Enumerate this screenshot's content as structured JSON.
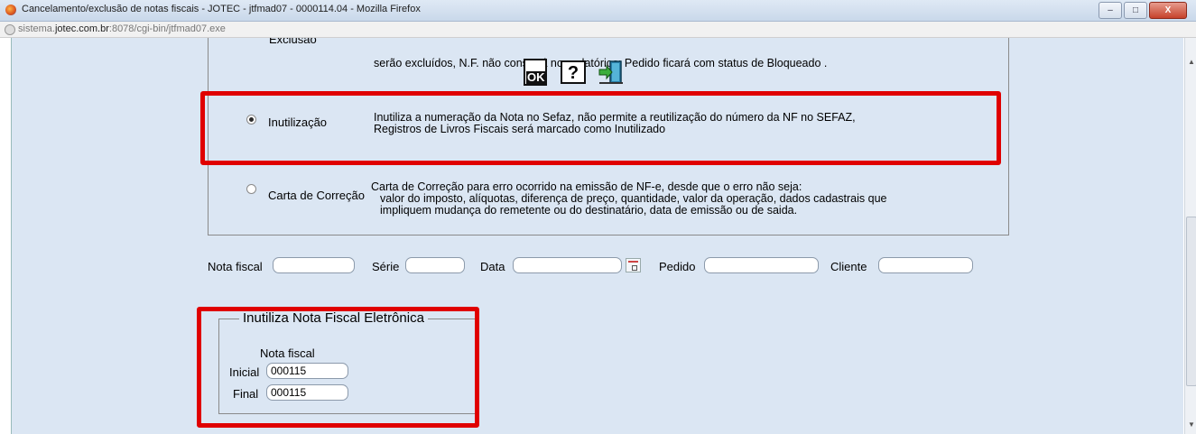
{
  "window": {
    "title": "Cancelamento/exclusão de notas fiscais - JOTEC - jtfmad07 - 0000114.04 - Mozilla Firefox",
    "minimize_label": "–",
    "maximize_label": "□",
    "close_label": "X"
  },
  "urlbar": {
    "prefix": "sistema.",
    "domain": "jotec.com.br",
    "rest": ":8078/cgi-bin/jtfmad07.exe"
  },
  "options": [
    {
      "label": "Exclusão",
      "selected": false,
      "description": [
        "serão excluídos, N.F. não constará nos relatórios; Pedido ficará com status de Bloqueado ."
      ]
    },
    {
      "label": "Inutilização",
      "selected": true,
      "description": [
        "Inutiliza a numeração da Nota no Sefaz, não permite a reutilização do número da NF no SEFAZ,",
        "Registros de Livros Fiscais será marcado como Inutilizado"
      ]
    },
    {
      "label": "Carta de Correção",
      "selected": false,
      "description": [
        "Carta de Correção para erro ocorrido na emissão de NF-e, desde que o erro não seja:",
        "valor do imposto, alíquotas, diferença de preço, quantidade, valor da operação, dados cadastrais que",
        "impliquem mudança do remetente ou do destinatário, data de emissão ou de saida."
      ]
    }
  ],
  "toolbar": {
    "ok_label": "OK",
    "help_label": "?"
  },
  "filters": {
    "nota_fiscal_label": "Nota fiscal",
    "nota_fiscal_value": "",
    "serie_label": "Série",
    "serie_value": "",
    "data_label": "Data",
    "data_value": "",
    "pedido_label": "Pedido",
    "pedido_value": "",
    "cliente_label": "Cliente",
    "cliente_value": ""
  },
  "inutiliza": {
    "legend": "Inutiliza Nota Fiscal Eletrônica",
    "subtitle": "Nota fiscal",
    "inicial_label": "Inicial",
    "inicial_value": "000115",
    "final_label": "Final",
    "final_value": "000115"
  },
  "colors": {
    "highlight": "#e00000",
    "panel_bg": "#dbe6f3"
  }
}
